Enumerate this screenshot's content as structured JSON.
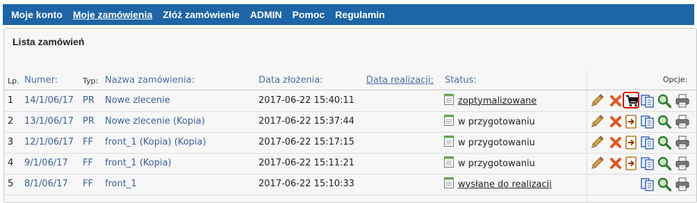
{
  "nav": {
    "items": [
      {
        "label": "Moje konto",
        "active": false
      },
      {
        "label": "Moje zamówienia",
        "active": true
      },
      {
        "label": "Złóż zamówienie",
        "active": false
      },
      {
        "label": "ADMIN",
        "active": false
      },
      {
        "label": "Pomoc",
        "active": false
      },
      {
        "label": "Regulamin",
        "active": false
      }
    ]
  },
  "panel": {
    "title": "Lista zamówień"
  },
  "table": {
    "headers": {
      "lp": "Lp.",
      "number": "Numer:",
      "type": "Typ:",
      "name": "Nazwa zamówienia:",
      "date_created": "Data złożenia:",
      "date_realization": "Data realizacji:",
      "status": "Status:",
      "options": "Opcje:"
    },
    "rows": [
      {
        "lp": "1",
        "number": "14/1/06/17",
        "type": "PR",
        "name": "Nowe zlecenie",
        "date": "2017-06-22 15:40:11",
        "status": "zoptymalizowane",
        "status_link": true
      },
      {
        "lp": "2",
        "number": "13/1/06/17",
        "type": "PR",
        "name": "Nowe zlecenie (Kopia)",
        "date": "2017-06-22 15:37:44",
        "status": "w przygotowaniu",
        "status_link": false
      },
      {
        "lp": "3",
        "number": "12/1/06/17",
        "type": "FF",
        "name": "front_1 (Kopia) (Kopia)",
        "date": "2017-06-22 15:17:15",
        "status": "w przygotowaniu",
        "status_link": false
      },
      {
        "lp": "4",
        "number": "9/1/06/17",
        "type": "FF",
        "name": "front_1 (Kopia)",
        "date": "2017-06-22 15:11:21",
        "status": "w przygotowaniu",
        "status_link": false
      },
      {
        "lp": "5",
        "number": "8/1/06/17",
        "type": "FF",
        "name": "front_1",
        "date": "2017-06-22 15:10:33",
        "status": "wysłane do realizacji",
        "status_link": true
      }
    ]
  },
  "icons": {
    "edit": "pencil-icon",
    "delete": "delete-x-icon",
    "cart": "cart-icon",
    "export": "export-icon",
    "copy": "copy-icon",
    "view": "magnifier-icon",
    "print": "printer-icon"
  },
  "colors": {
    "nav_bg": "#1d65a6",
    "link": "#3c5f99",
    "highlight": "#e00000"
  }
}
